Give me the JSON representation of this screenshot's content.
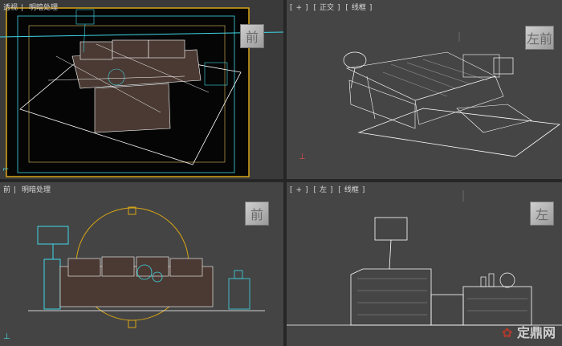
{
  "viewports": {
    "perspective": {
      "labels": [
        "透视",
        "明暗处理"
      ],
      "cube": "前"
    },
    "top": {
      "labels": [
        "+",
        "正交",
        "线框"
      ],
      "cube": "左前"
    },
    "front": {
      "labels": [
        "前",
        "明暗处理"
      ],
      "cube": "前"
    },
    "left": {
      "labels": [
        "+",
        "左",
        "线框"
      ],
      "cube": "左"
    }
  },
  "watermark": "定鼎网",
  "colors": {
    "active_border": "#d8a516",
    "viewport_bg": "#444444",
    "wire": "#ffffff",
    "cyan": "#3fd7e6",
    "sofa": "#4a3a33"
  }
}
